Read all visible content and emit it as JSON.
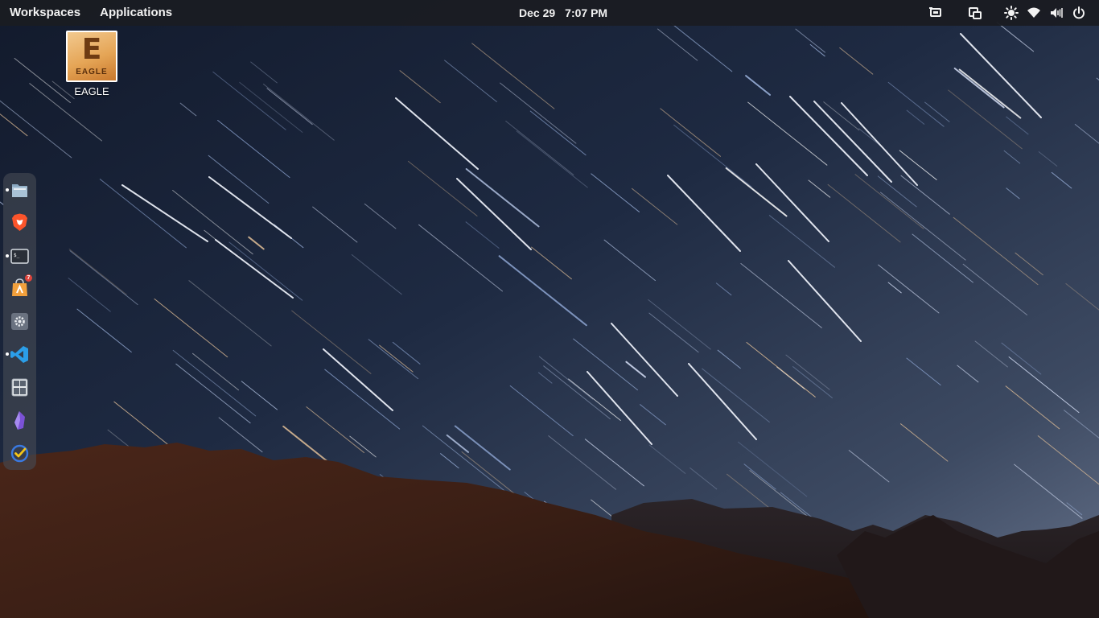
{
  "panel": {
    "workspaces_label": "Workspaces",
    "applications_label": "Applications",
    "date": "Dec 29",
    "time": "7:07 PM",
    "indicators": [
      "screen-share-icon",
      "screen-rotate-icon",
      "brightness-icon",
      "wifi-icon",
      "volume-icon",
      "power-icon"
    ]
  },
  "desktop": {
    "icons": [
      {
        "label": "EAGLE",
        "tile_letter": "E",
        "tile_word": "EAGLE",
        "icon": "eagle-app-icon"
      }
    ]
  },
  "dock": {
    "items": [
      {
        "name": "files",
        "icon": "folder-icon",
        "running": true
      },
      {
        "name": "brave",
        "icon": "brave-lion-icon",
        "running": false
      },
      {
        "name": "terminal",
        "icon": "terminal-icon",
        "running": true
      },
      {
        "name": "appcenter",
        "icon": "appcenter-icon",
        "running": false,
        "badge": "7"
      },
      {
        "name": "settings",
        "icon": "gear-icon",
        "running": false
      },
      {
        "name": "vscode",
        "icon": "vscode-icon",
        "running": true
      },
      {
        "name": "calculator",
        "icon": "calculator-icon",
        "running": false
      },
      {
        "name": "obsidian",
        "icon": "obsidian-crystal-icon",
        "running": false
      },
      {
        "name": "tasks",
        "icon": "check-circle-icon",
        "running": false
      }
    ]
  },
  "colors": {
    "panel_bg": "#1a1c22",
    "sky_top": "#141b2d",
    "sky_bottom": "#5d6a80",
    "mountain": "#3a2016",
    "badge": "#e0443c"
  }
}
